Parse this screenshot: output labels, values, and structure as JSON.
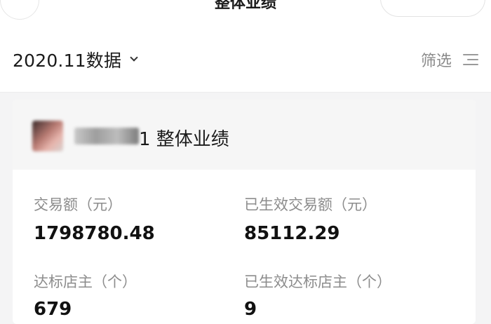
{
  "nav": {
    "title": "整体业绩"
  },
  "filter_bar": {
    "month_label": "2020.11数据",
    "filter_label": "筛选"
  },
  "card": {
    "title_suffix": "1  整体业绩",
    "stats": [
      {
        "label": "交易额（元）",
        "value": "1798780.48"
      },
      {
        "label": "已生效交易额（元）",
        "value": "85112.29"
      },
      {
        "label": "达标店主（个）",
        "value": "679"
      },
      {
        "label": "已生效达标店主（个）",
        "value": "9"
      }
    ]
  },
  "icons": {
    "back": "chevron-left-icon",
    "more": "more-dots-icon",
    "close": "close-circle-icon",
    "dropdown": "chevron-down-icon",
    "filter": "filter-lines-icon"
  },
  "colors": {
    "background": "#f4f4f5",
    "label_gray": "#8c8c8c",
    "text_dark": "#111111"
  }
}
